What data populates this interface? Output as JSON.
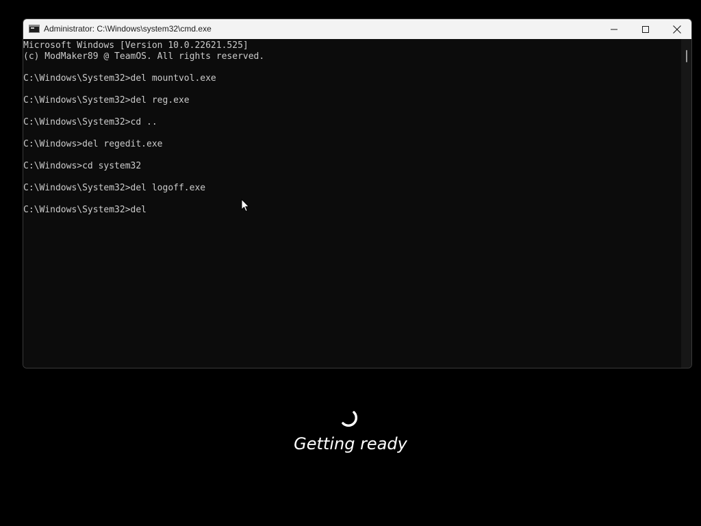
{
  "window": {
    "title": "Administrator: C:\\Windows\\system32\\cmd.exe",
    "app_icon": "cmd-icon",
    "buttons": [
      "minimize-icon",
      "maximize-icon",
      "close-icon"
    ]
  },
  "console": {
    "lines": [
      "Microsoft Windows [Version 10.0.22621.525]",
      "(c) ModMaker89 @ TeamOS. All rights reserved.",
      "",
      "C:\\Windows\\System32>del mountvol.exe",
      "",
      "C:\\Windows\\System32>del reg.exe",
      "",
      "C:\\Windows\\System32>cd ..",
      "",
      "C:\\Windows>del regedit.exe",
      "",
      "C:\\Windows>cd system32",
      "",
      "C:\\Windows\\System32>del logoff.exe",
      "",
      "C:\\Windows\\System32>del"
    ],
    "foreground": "#cccccc",
    "background": "#0c0c0c"
  },
  "status": {
    "text": "Getting ready",
    "icon": "loading-spinner-icon"
  },
  "colors": {
    "desktop": "#000000",
    "titlebar": "#f3f3f3"
  }
}
